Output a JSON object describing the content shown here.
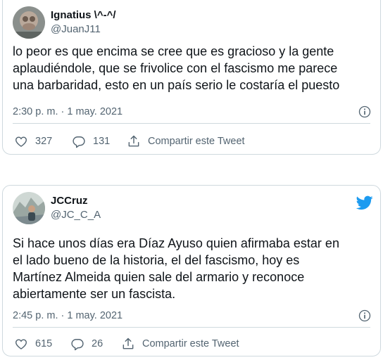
{
  "tweets": [
    {
      "display_name": "Ignatius \\^-^/",
      "handle": "@JuanJ11",
      "text": "lo peor es que encima se cree que es gracioso y la gente\naplaudiéndole, que se frivolice con el fascismo me parece\nuna barbaridad, esto en un país serio le costaría el puesto",
      "timestamp": "2:30 p. m. · 1 may. 2021",
      "likes": "327",
      "replies": "131",
      "share_label": "Compartir este Tweet"
    },
    {
      "display_name": "JCCruz",
      "handle": "@JC_C_A",
      "text": "Si hace unos días era Díaz Ayuso quien afirmaba estar en\nel lado bueno de la historia, el del fascismo, hoy es\nMartínez Almeida quien sale del armario y reconoce\nabiertamente ser un fascista.",
      "timestamp": "2:45 p. m. · 1 may. 2021",
      "likes": "615",
      "replies": "26",
      "share_label": "Compartir este Tweet"
    }
  ],
  "icons": {
    "like": "heart-icon",
    "reply": "reply-icon",
    "share": "share-icon",
    "info": "info-icon",
    "brand": "twitter-bird-icon"
  },
  "colors": {
    "twitter_blue": "#1d9bf0",
    "secondary_text": "#536471",
    "border": "#cfd9de"
  }
}
